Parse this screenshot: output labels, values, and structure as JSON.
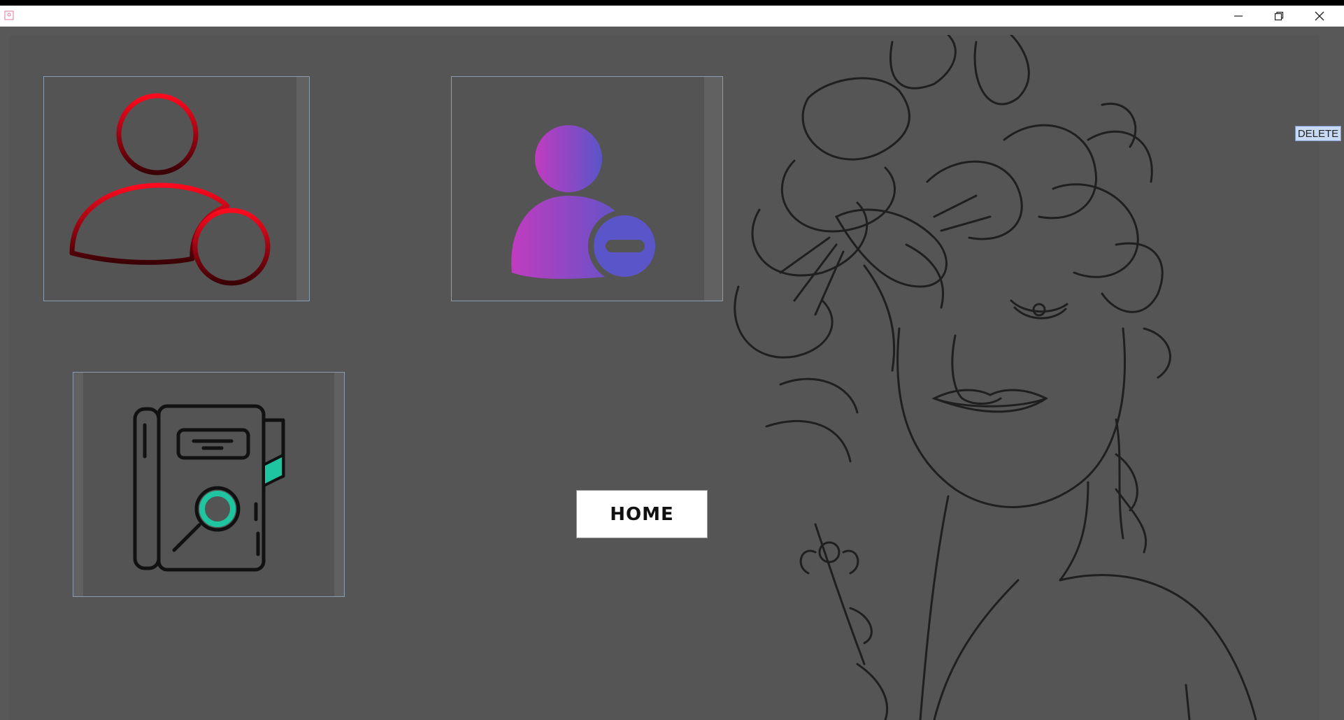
{
  "window": {
    "minimize_icon": "minimize-icon",
    "maximize_icon": "restore-icon",
    "close_icon": "close-icon"
  },
  "tiles": {
    "add_user_icon": "add-user-icon",
    "remove_user_icon": "remove-user-icon",
    "search_record_icon": "search-record-icon"
  },
  "home_button": {
    "label": "HOME"
  },
  "delete_label": {
    "text": "DELETE"
  },
  "colors": {
    "frame_bg": "#585858",
    "add_red": "#e0001a",
    "remove_purple": "#b23fc0",
    "remove_blue": "#5a55c8",
    "search_teal": "#1fc4a0"
  }
}
